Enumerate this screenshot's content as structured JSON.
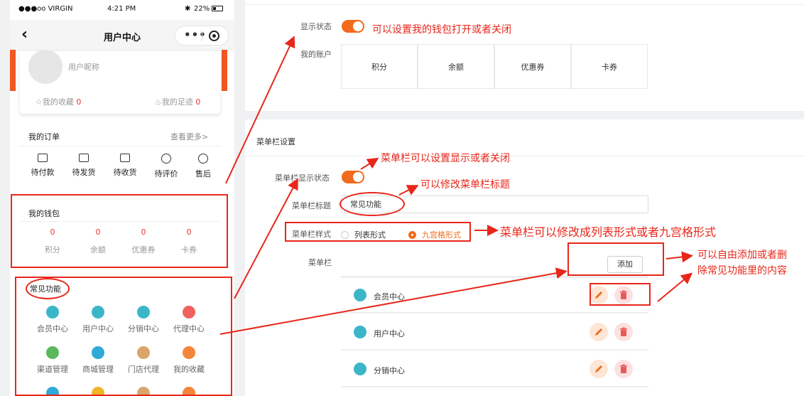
{
  "phone": {
    "status": {
      "carrier": "●●●oo VIRGIN",
      "time": "4:21 PM",
      "battery": "22%"
    },
    "nav": {
      "title": "用户中心",
      "back_icon": "chevron-left-icon",
      "more_icon": "more-dots-icon",
      "close_icon": "target-icon"
    },
    "user": {
      "nickname": "用户昵称",
      "favorites_label": "我的收藏",
      "favorites_count": "0",
      "footprint_label": "我的足迹",
      "footprint_count": "0"
    },
    "orders": {
      "title": "我的订单",
      "more": "查看更多>",
      "items": [
        {
          "label": "待付款",
          "icon": "wallet-icon"
        },
        {
          "label": "待发货",
          "icon": "box-icon"
        },
        {
          "label": "待收货",
          "icon": "truck-icon"
        },
        {
          "label": "待评价",
          "icon": "comment-icon"
        },
        {
          "label": "售后",
          "icon": "after-sales-icon"
        }
      ]
    },
    "wallet": {
      "title": "我的钱包",
      "items": [
        {
          "label": "积分",
          "value": "0"
        },
        {
          "label": "余额",
          "value": "0"
        },
        {
          "label": "优惠券",
          "value": "0"
        },
        {
          "label": "卡券",
          "value": "0"
        }
      ]
    },
    "functions": {
      "title": "常见功能",
      "items": [
        {
          "label": "会员中心",
          "color": "#3bb6c9"
        },
        {
          "label": "用户中心",
          "color": "#3bb6c9"
        },
        {
          "label": "分销中心",
          "color": "#3bb6c9"
        },
        {
          "label": "代理中心",
          "color": "#f0625f"
        },
        {
          "label": "渠道管理",
          "color": "#5cb85c"
        },
        {
          "label": "商城管理",
          "color": "#2fa9d8"
        },
        {
          "label": "门店代理",
          "color": "#d9a56a"
        },
        {
          "label": "我的收藏",
          "color": "#f5853b"
        }
      ]
    }
  },
  "settings": {
    "display_status_label": "显示状态",
    "my_account_label": "我的账户",
    "account_cells": [
      "积分",
      "余额",
      "优惠券",
      "卡券"
    ],
    "menu_section_title": "菜单栏设置",
    "menu_display_label": "菜单栏显示状态",
    "menu_title_label": "菜单栏标题",
    "menu_title_value": "常见功能",
    "menu_style_label": "菜单栏样式",
    "style_options": [
      "列表形式",
      "九宫格形式"
    ],
    "menu_label": "菜单栏",
    "add_button": "添加",
    "menu_rows": [
      {
        "name": "会员中心",
        "color": "#3bb6c9"
      },
      {
        "name": "用户中心",
        "color": "#3bb6c9"
      },
      {
        "name": "分销中心",
        "color": "#3bb6c9"
      }
    ]
  },
  "annotations": {
    "wallet_toggle": "可以设置我的钱包打开或者关闭",
    "menu_toggle": "菜单栏可以设置显示或者关闭",
    "menu_title": "可以修改菜单栏标题",
    "menu_style": "菜单栏可以修改成列表形式或者九宫格形式",
    "add_delete_line1": "可以自由添加或者删",
    "add_delete_line2": "除常见功能里的内容"
  },
  "colors": {
    "accent": "#f26a1b",
    "annotation": "#e8261a",
    "value_red": "#e33"
  }
}
